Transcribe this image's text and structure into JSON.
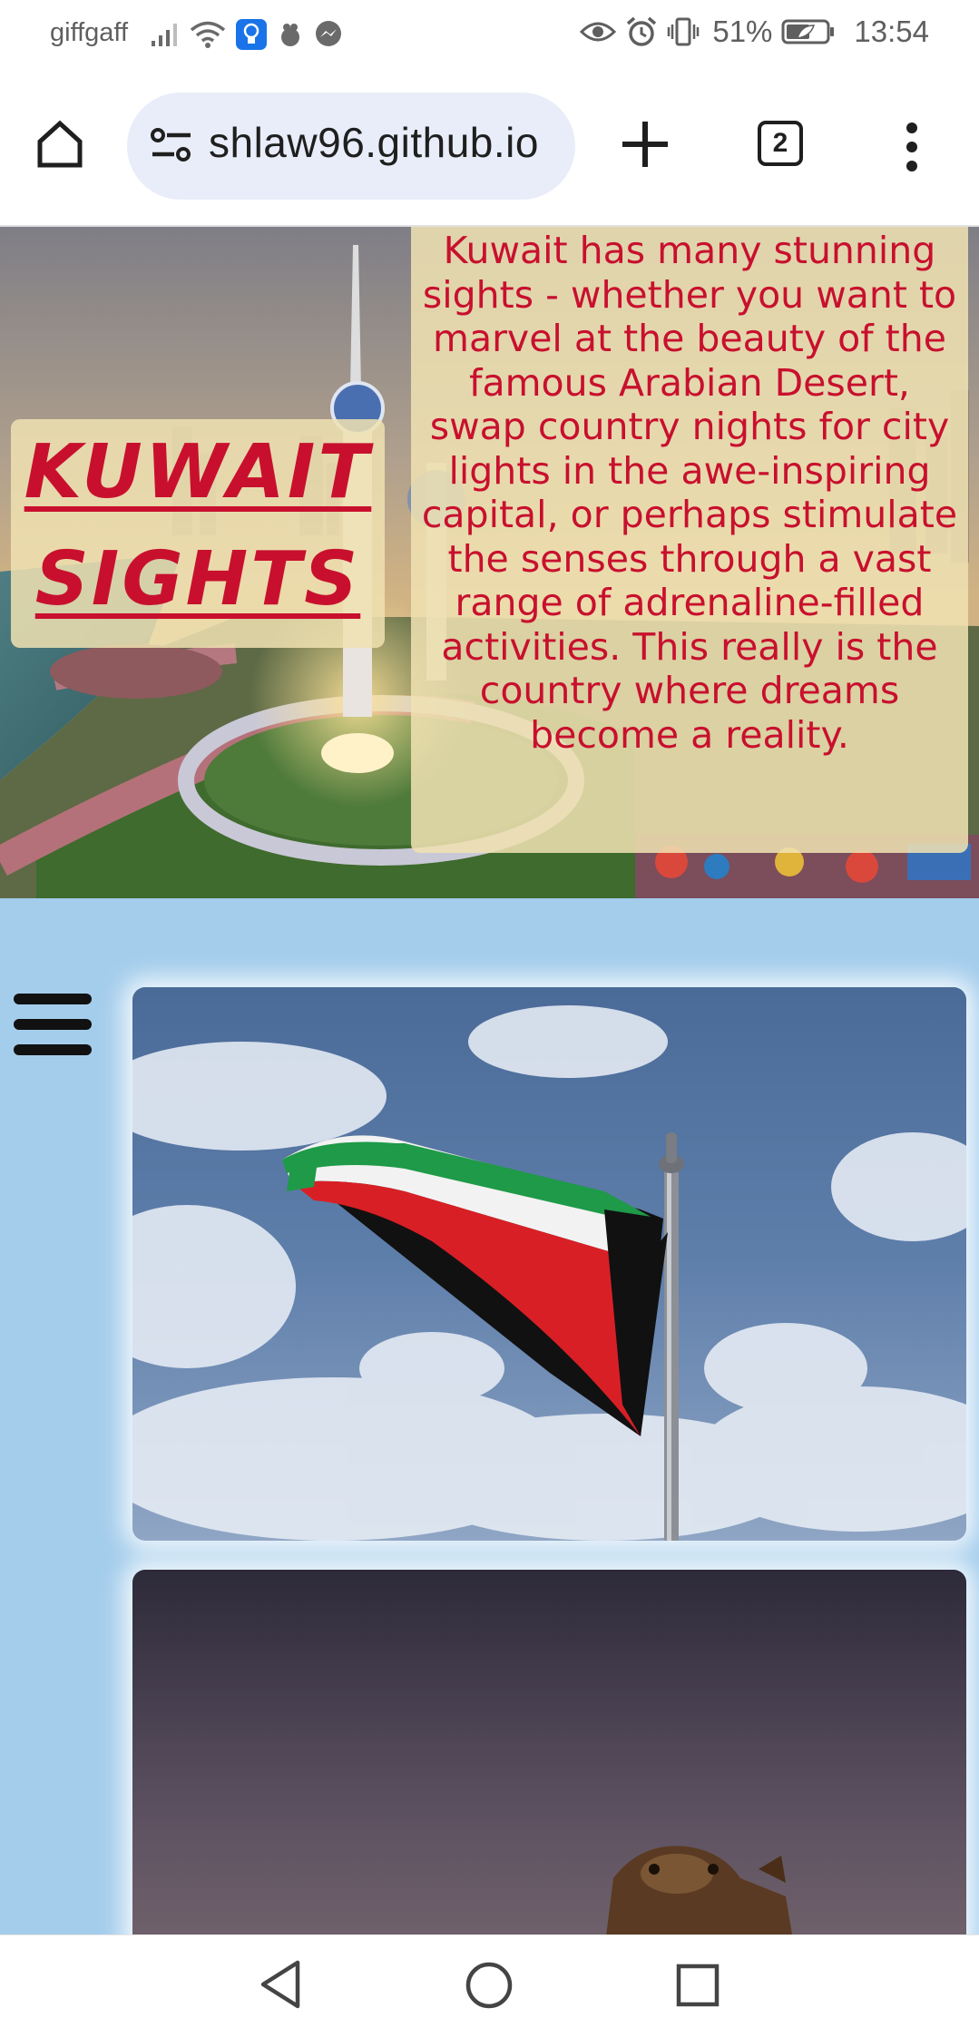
{
  "status_bar": {
    "carrier": "giffgaff",
    "battery": "51%",
    "time": "13:54",
    "icons": [
      "signal-icon",
      "wifi-icon",
      "lightbulb-app-icon",
      "app-notification-icon",
      "messenger-icon",
      "eye-comfort-icon",
      "alarm-icon",
      "vibrate-icon",
      "battery-icon"
    ]
  },
  "browser": {
    "url": "ashlaw96.github.io",
    "url_visible": "shlaw96.github.io",
    "tab_count": "2",
    "icons": [
      "home-icon",
      "site-settings-icon",
      "new-tab-icon",
      "tab-switcher-icon",
      "more-menu-icon"
    ]
  },
  "hero": {
    "title_line1": "KUWAIT",
    "title_line2": "SIGHTS",
    "description": "Kuwait has many stunning sights - whether you want to marvel at the beauty of the famous Arabian Desert, swap country nights for city lights in the awe-inspiring capital, or perhaps stimulate the senses through a vast range of adrenaline-filled activities. This really is the country where dreams become a reality."
  },
  "main": {
    "menu_icon": "hamburger-menu-icon",
    "images": [
      "kuwait-flag-photo",
      "camel-photo"
    ]
  },
  "system_nav": {
    "icons": [
      "back-icon",
      "home-circle-icon",
      "recents-icon"
    ]
  },
  "colors": {
    "accent_red": "#c8102e",
    "caption_bg": "#f0e2b2",
    "main_bg": "#a4cdec",
    "url_pill": "#e8edf9"
  }
}
